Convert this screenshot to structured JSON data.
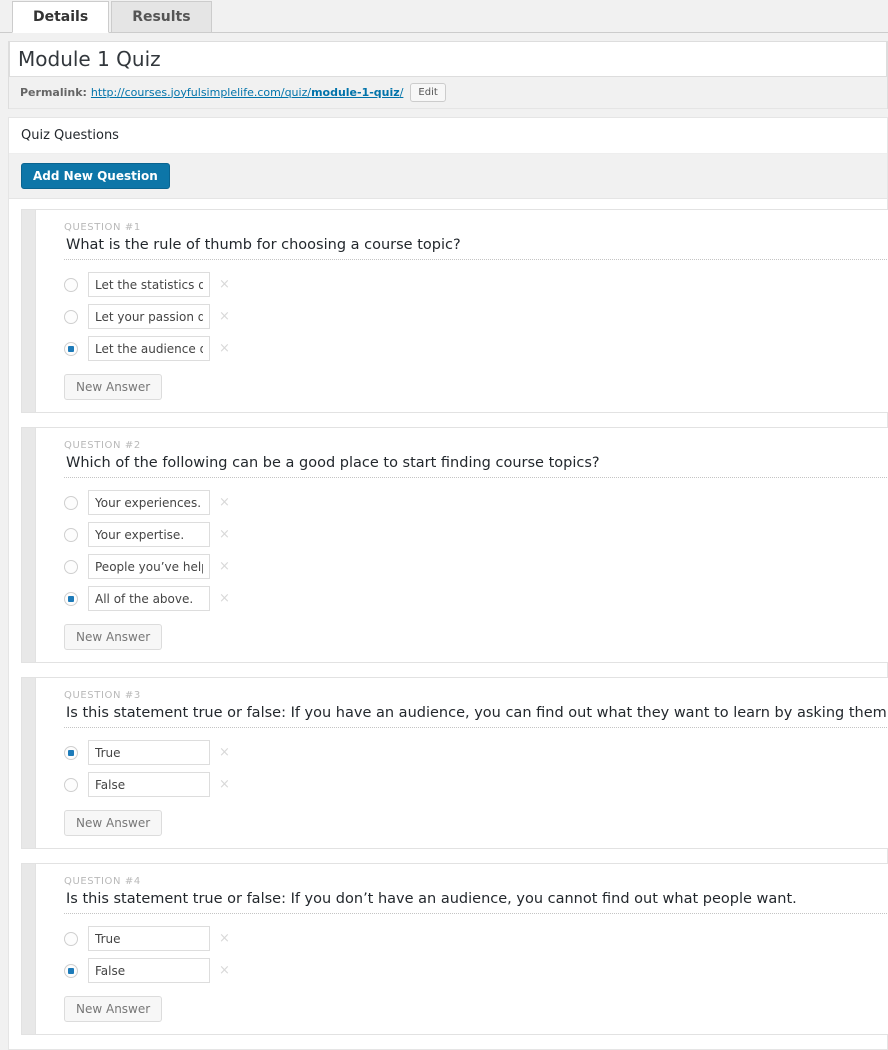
{
  "tabs": [
    {
      "label": "Details",
      "active": true
    },
    {
      "label": "Results",
      "active": false
    }
  ],
  "title": {
    "value": "Module 1 Quiz"
  },
  "permalink": {
    "label": "Permalink:",
    "url_prefix": "http://courses.joyfulsimplelife.com/quiz/",
    "url_slug": "module-1-quiz",
    "url_suffix": "/",
    "edit_label": "Edit"
  },
  "panel": {
    "heading": "Quiz Questions",
    "add_question_label": "Add New Question",
    "new_answer_label": "New Answer",
    "remove_icon": "×",
    "accent_color": "#0d76a8",
    "selected_radio_color": "#1d7bb9"
  },
  "questions": [
    {
      "label": "QUESTION #1",
      "text": "What is the rule of thumb for choosing a course topic?",
      "answers": [
        {
          "text": "Let the statistics direct y",
          "selected": false
        },
        {
          "text": "Let your passion direct y",
          "selected": false
        },
        {
          "text": "Let the audience direct",
          "selected": true
        }
      ]
    },
    {
      "label": "QUESTION #2",
      "text": "Which of the following can be a good place to start finding course topics?",
      "answers": [
        {
          "text": "Your experiences.",
          "selected": false
        },
        {
          "text": "Your expertise.",
          "selected": false
        },
        {
          "text": "People you’ve helped.",
          "selected": false
        },
        {
          "text": "All of the above.",
          "selected": true
        }
      ]
    },
    {
      "label": "QUESTION #3",
      "text": "Is this statement true or false: If you have an audience, you can find out what they want to learn by asking them in a survey.",
      "answers": [
        {
          "text": "True",
          "selected": true
        },
        {
          "text": "False",
          "selected": false
        }
      ]
    },
    {
      "label": "QUESTION #4",
      "text": "Is this statement true or false: If you don’t have an audience, you cannot find out what people want.",
      "answers": [
        {
          "text": "True",
          "selected": false
        },
        {
          "text": "False",
          "selected": true
        }
      ]
    }
  ]
}
